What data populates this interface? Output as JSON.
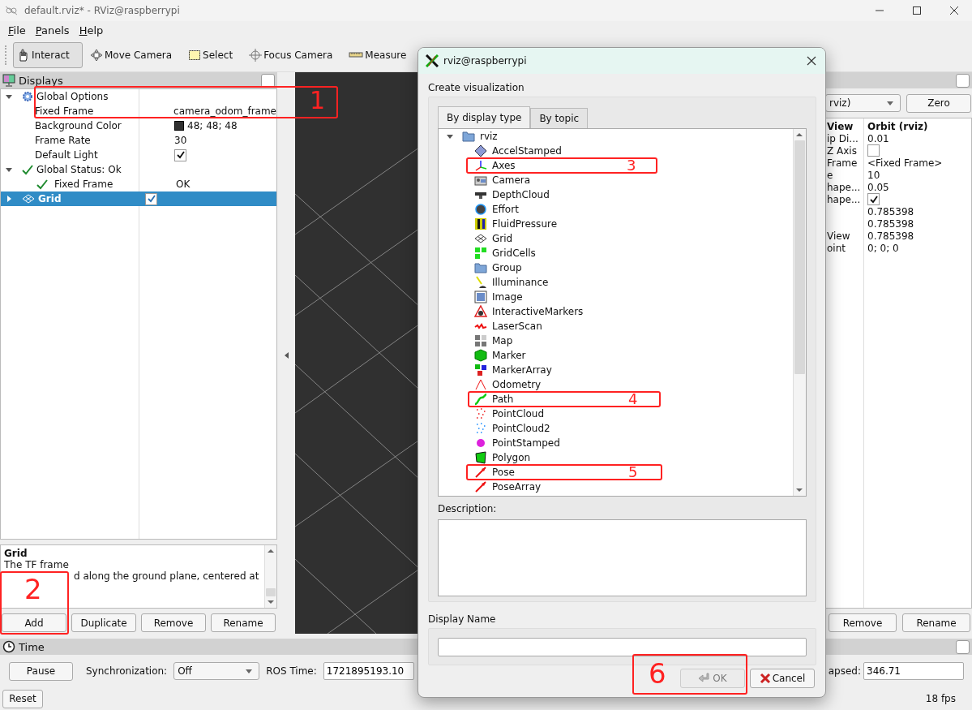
{
  "window": {
    "title": "default.rviz* - RViz@raspberrypi"
  },
  "menu": [
    {
      "label": "File"
    },
    {
      "label": "Panels"
    },
    {
      "label": "Help"
    }
  ],
  "toolbar": [
    {
      "label": "Interact",
      "selected": true
    },
    {
      "label": "Move Camera",
      "selected": false
    },
    {
      "label": "Select",
      "selected": false
    },
    {
      "label": "Focus Camera",
      "selected": false
    },
    {
      "label": "Measure",
      "selected": false
    }
  ],
  "displays": {
    "title": "Displays",
    "floating": false,
    "items": [
      {
        "label": "Global Options",
        "kind": "options",
        "expanded": true,
        "selected": false,
        "children": [
          {
            "label": "Fixed Frame",
            "kind": "text",
            "value": "camera_odom_frame"
          },
          {
            "label": "Background Color",
            "kind": "color",
            "value": "48; 48; 48",
            "color": "#303030"
          },
          {
            "label": "Frame Rate",
            "kind": "text",
            "value": "30"
          },
          {
            "label": "Default Light",
            "kind": "checkbox",
            "checked": true
          }
        ]
      },
      {
        "label": "Global Status: Ok",
        "kind": "status",
        "expanded": true,
        "selected": false,
        "children": [
          {
            "label": "Fixed Frame",
            "kind": "status",
            "value": "OK"
          }
        ]
      },
      {
        "label": "Grid",
        "kind": "display",
        "expanded": false,
        "selected": true,
        "checked": true
      }
    ],
    "description": {
      "title": "Grid",
      "lines": [
        "The TF frame",
        "d along the ground plane, centered at"
      ]
    },
    "buttons": [
      "Add",
      "Duplicate",
      "Remove",
      "Rename"
    ]
  },
  "views": {
    "floating": false,
    "view_type": "rviz)",
    "zero": "Zero",
    "properties": [
      {
        "label": "View",
        "value": "Orbit (rviz)",
        "kind": "header"
      },
      {
        "label": "ip Di...",
        "value": "0.01",
        "kind": "text"
      },
      {
        "label": "Z Axis",
        "kind": "checkbox",
        "checked": false
      },
      {
        "label": "Frame",
        "value": "<Fixed Frame>",
        "kind": "text"
      },
      {
        "label": "e",
        "value": "10",
        "kind": "text"
      },
      {
        "label": "hape...",
        "value": "0.05",
        "kind": "text"
      },
      {
        "label": "hape...",
        "kind": "checkbox",
        "checked": true
      },
      {
        "value": "0.785398",
        "kind": "text"
      },
      {
        "value": "0.785398",
        "kind": "text"
      },
      {
        "label": "View",
        "value": "0.785398",
        "kind": "text"
      },
      {
        "label": "oint",
        "value": "0; 0; 0",
        "kind": "text"
      }
    ],
    "buttons": [
      "Remove",
      "Rename"
    ]
  },
  "time": {
    "title": "Time",
    "floating": false,
    "pause": "Pause",
    "sync_label": "Synchronization:",
    "sync_value": "Off",
    "ros_time_label": "ROS Time:",
    "ros_time": "1721895193.10",
    "elapsed_label": "apsed:",
    "elapsed": "346.71",
    "reset": "Reset",
    "fps": "18 fps"
  },
  "dialog": {
    "title": "rviz@raspberrypi",
    "heading": "Create visualization",
    "tabs": [
      {
        "label": "By display type",
        "selected": true
      },
      {
        "label": "By topic",
        "selected": false
      }
    ],
    "tree": {
      "label": "rviz",
      "expanded": true,
      "children": [
        {
          "label": "AccelStamped"
        },
        {
          "label": "Axes"
        },
        {
          "label": "Camera"
        },
        {
          "label": "DepthCloud"
        },
        {
          "label": "Effort"
        },
        {
          "label": "FluidPressure"
        },
        {
          "label": "Grid"
        },
        {
          "label": "GridCells"
        },
        {
          "label": "Group"
        },
        {
          "label": "Illuminance"
        },
        {
          "label": "Image"
        },
        {
          "label": "InteractiveMarkers"
        },
        {
          "label": "LaserScan"
        },
        {
          "label": "Map"
        },
        {
          "label": "Marker"
        },
        {
          "label": "MarkerArray"
        },
        {
          "label": "Odometry"
        },
        {
          "label": "Path"
        },
        {
          "label": "PointCloud"
        },
        {
          "label": "PointCloud2"
        },
        {
          "label": "PointStamped"
        },
        {
          "label": "Polygon"
        },
        {
          "label": "Pose"
        },
        {
          "label": "PoseArray"
        }
      ]
    },
    "description_label": "Description:",
    "display_name_label": "Display Name",
    "ok": {
      "label": "OK",
      "disabled": true
    },
    "cancel": "Cancel"
  },
  "annotations": [
    {
      "label": "1"
    },
    {
      "label": "2"
    },
    {
      "label": "3"
    },
    {
      "label": "4"
    },
    {
      "label": "5"
    },
    {
      "label": "6"
    }
  ]
}
